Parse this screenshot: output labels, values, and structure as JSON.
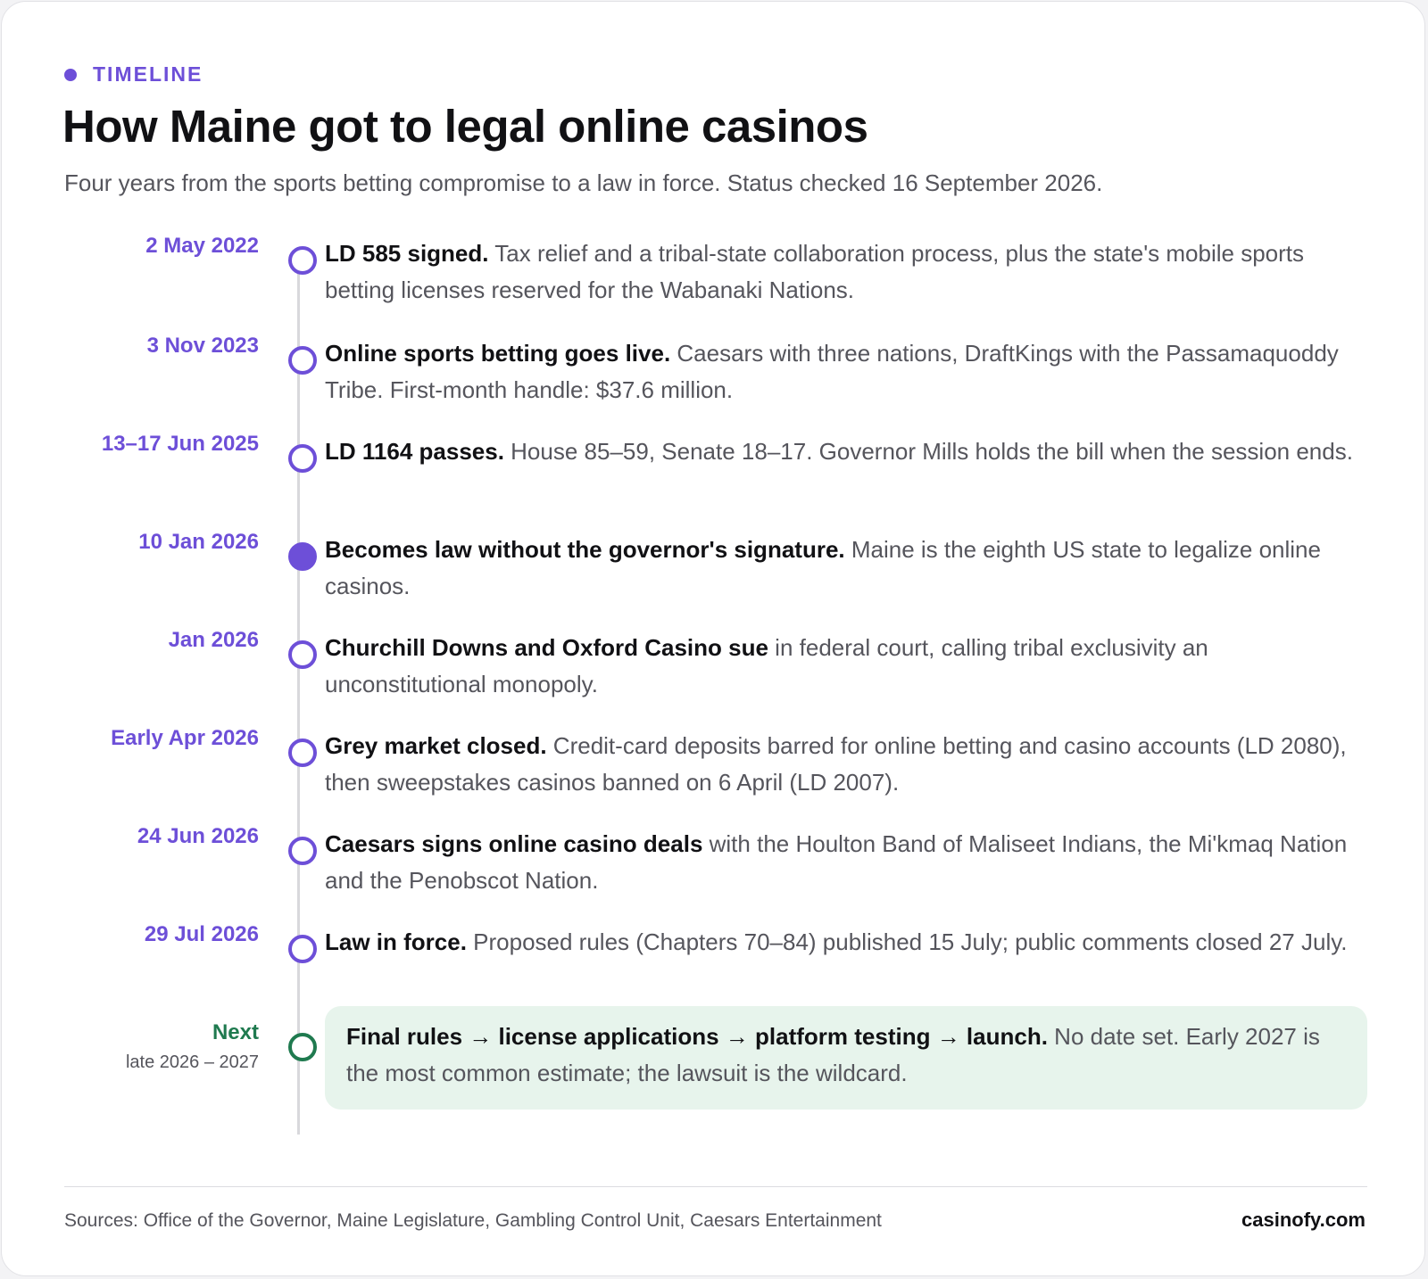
{
  "header": {
    "eyebrow": "TIMELINE",
    "title": "How Maine got to legal online casinos",
    "subtitle": "Four years from the sports betting compromise to a law in force. Status checked 16 September 2026."
  },
  "events": [
    {
      "date": "2 May 2022",
      "bold": "LD 585 signed.",
      "rest": " Tax relief and a tribal-state collaboration process, plus the state's mobile sports betting licenses reserved for the Wabanaki Nations."
    },
    {
      "date": "3 Nov 2023",
      "bold": "Online sports betting goes live.",
      "rest": " Caesars with three nations, DraftKings with the Passamaquoddy Tribe. First-month handle: $37.6 million."
    },
    {
      "date": "13–17 Jun 2025",
      "bold": "LD 1164 passes.",
      "rest": " House 85–59, Senate 18–17. Governor Mills holds the bill when the session ends."
    },
    {
      "date": "10 Jan 2026",
      "bold": "Becomes law without the governor's signature.",
      "rest": " Maine is the eighth US state to legalize online casinos."
    },
    {
      "date": "Jan 2026",
      "bold": "Churchill Downs and Oxford Casino sue",
      "rest": " in federal court, calling tribal exclusivity an unconstitutional monopoly."
    },
    {
      "date": "Early Apr 2026",
      "bold": "Grey market closed.",
      "rest": " Credit-card deposits barred for online betting and casino accounts (LD 2080), then sweepstakes casinos banned on 6 April (LD 2007)."
    },
    {
      "date": "24 Jun 2026",
      "bold": "Caesars signs online casino deals",
      "rest": " with the Houlton Band of Maliseet Indians, the Mi'kmaq Nation and the Penobscot Nation."
    },
    {
      "date": "29 Jul 2026",
      "bold": "Law in force.",
      "rest": " Proposed rules (Chapters 70–84) published 15 July; public comments closed 27 July."
    }
  ],
  "next": {
    "label": "Next",
    "sub": "late 2026 – 2027",
    "bold": "Final rules → license applications → platform testing → launch.",
    "rest": " No date set. Early 2027 is the most common estimate; the lawsuit is the wildcard."
  },
  "footer": {
    "sources": "Sources: Office of the Governor, Maine Legislature, Gambling Control Unit, Caesars Entertainment",
    "brand": "casinofy.com"
  },
  "colors": {
    "accent": "#6d4fd8",
    "next_accent": "#1f7a4f",
    "next_bg": "#e7f4ec"
  }
}
